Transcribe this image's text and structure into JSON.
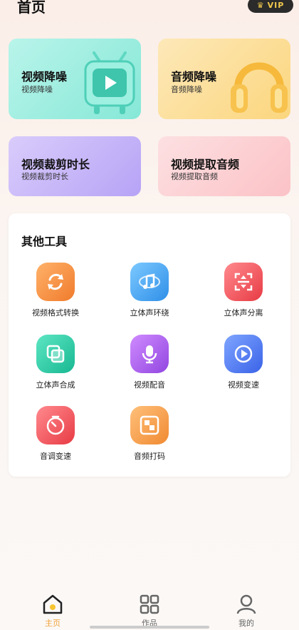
{
  "header": {
    "title": "首页",
    "vip_label": "VIP"
  },
  "feature_cards": [
    {
      "title": "视频降噪",
      "subtitle": "视频降噪",
      "icon": "tv-play-icon"
    },
    {
      "title": "音频降噪",
      "subtitle": "音频降噪",
      "icon": "headphones-icon"
    },
    {
      "title": "视频裁剪时长",
      "subtitle": "视频裁剪时长"
    },
    {
      "title": "视频提取音频",
      "subtitle": "视频提取音频"
    }
  ],
  "tools": {
    "title": "其他工具",
    "items": [
      {
        "label": "视频格式转换",
        "icon": "convert-arrows-icon",
        "color": "#f58a3a"
      },
      {
        "label": "立体声环绕",
        "icon": "music-note-icon",
        "color": "#3aa3f2"
      },
      {
        "label": "立体声分离",
        "icon": "split-scan-icon",
        "color": "#f2474e"
      },
      {
        "label": "立体声合成",
        "icon": "merge-squares-icon",
        "color": "#22c9a3"
      },
      {
        "label": "视频配音",
        "icon": "microphone-icon",
        "color": "#a451e8"
      },
      {
        "label": "视频变速",
        "icon": "play-circle-icon",
        "color": "#3e6ef0"
      },
      {
        "label": "音调变速",
        "icon": "timer-icon",
        "color": "#f2474e"
      },
      {
        "label": "音频打码",
        "icon": "mosaic-icon",
        "color": "#f59a3a"
      }
    ]
  },
  "tabbar": {
    "items": [
      {
        "label": "主页",
        "icon": "home-icon",
        "active": true
      },
      {
        "label": "作品",
        "icon": "grid-icon",
        "active": false
      },
      {
        "label": "我的",
        "icon": "user-icon",
        "active": false
      }
    ]
  },
  "colors": {
    "accent": "#f0a23b",
    "vip_text": "#f2c94c"
  }
}
